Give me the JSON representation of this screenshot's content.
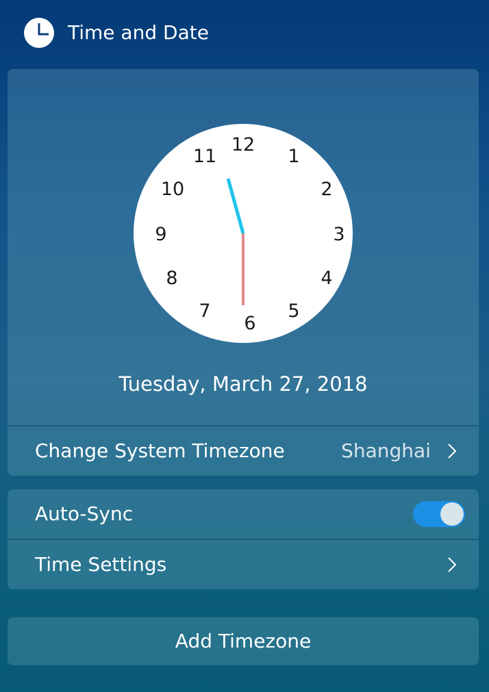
{
  "header": {
    "title": "Time and Date",
    "icon": "clock-icon"
  },
  "clock": {
    "numbers": [
      "12",
      "1",
      "2",
      "3",
      "4",
      "5",
      "6",
      "7",
      "8",
      "9",
      "10",
      "11"
    ],
    "time_shown": "11:30",
    "hour_hand_color": "#1ec3ea",
    "minute_hand_color": "#e08a8a"
  },
  "date": {
    "text": "Tuesday, March 27, 2018"
  },
  "timezone": {
    "label": "Change System Timezone",
    "value": "Shanghai",
    "icon": "chevron-right-icon"
  },
  "auto_sync": {
    "label": "Auto-Sync",
    "enabled": true,
    "toggle_color": "#1b8fe3"
  },
  "time_settings": {
    "label": "Time Settings",
    "icon": "chevron-right-icon"
  },
  "add_timezone": {
    "label": "Add Timezone"
  }
}
